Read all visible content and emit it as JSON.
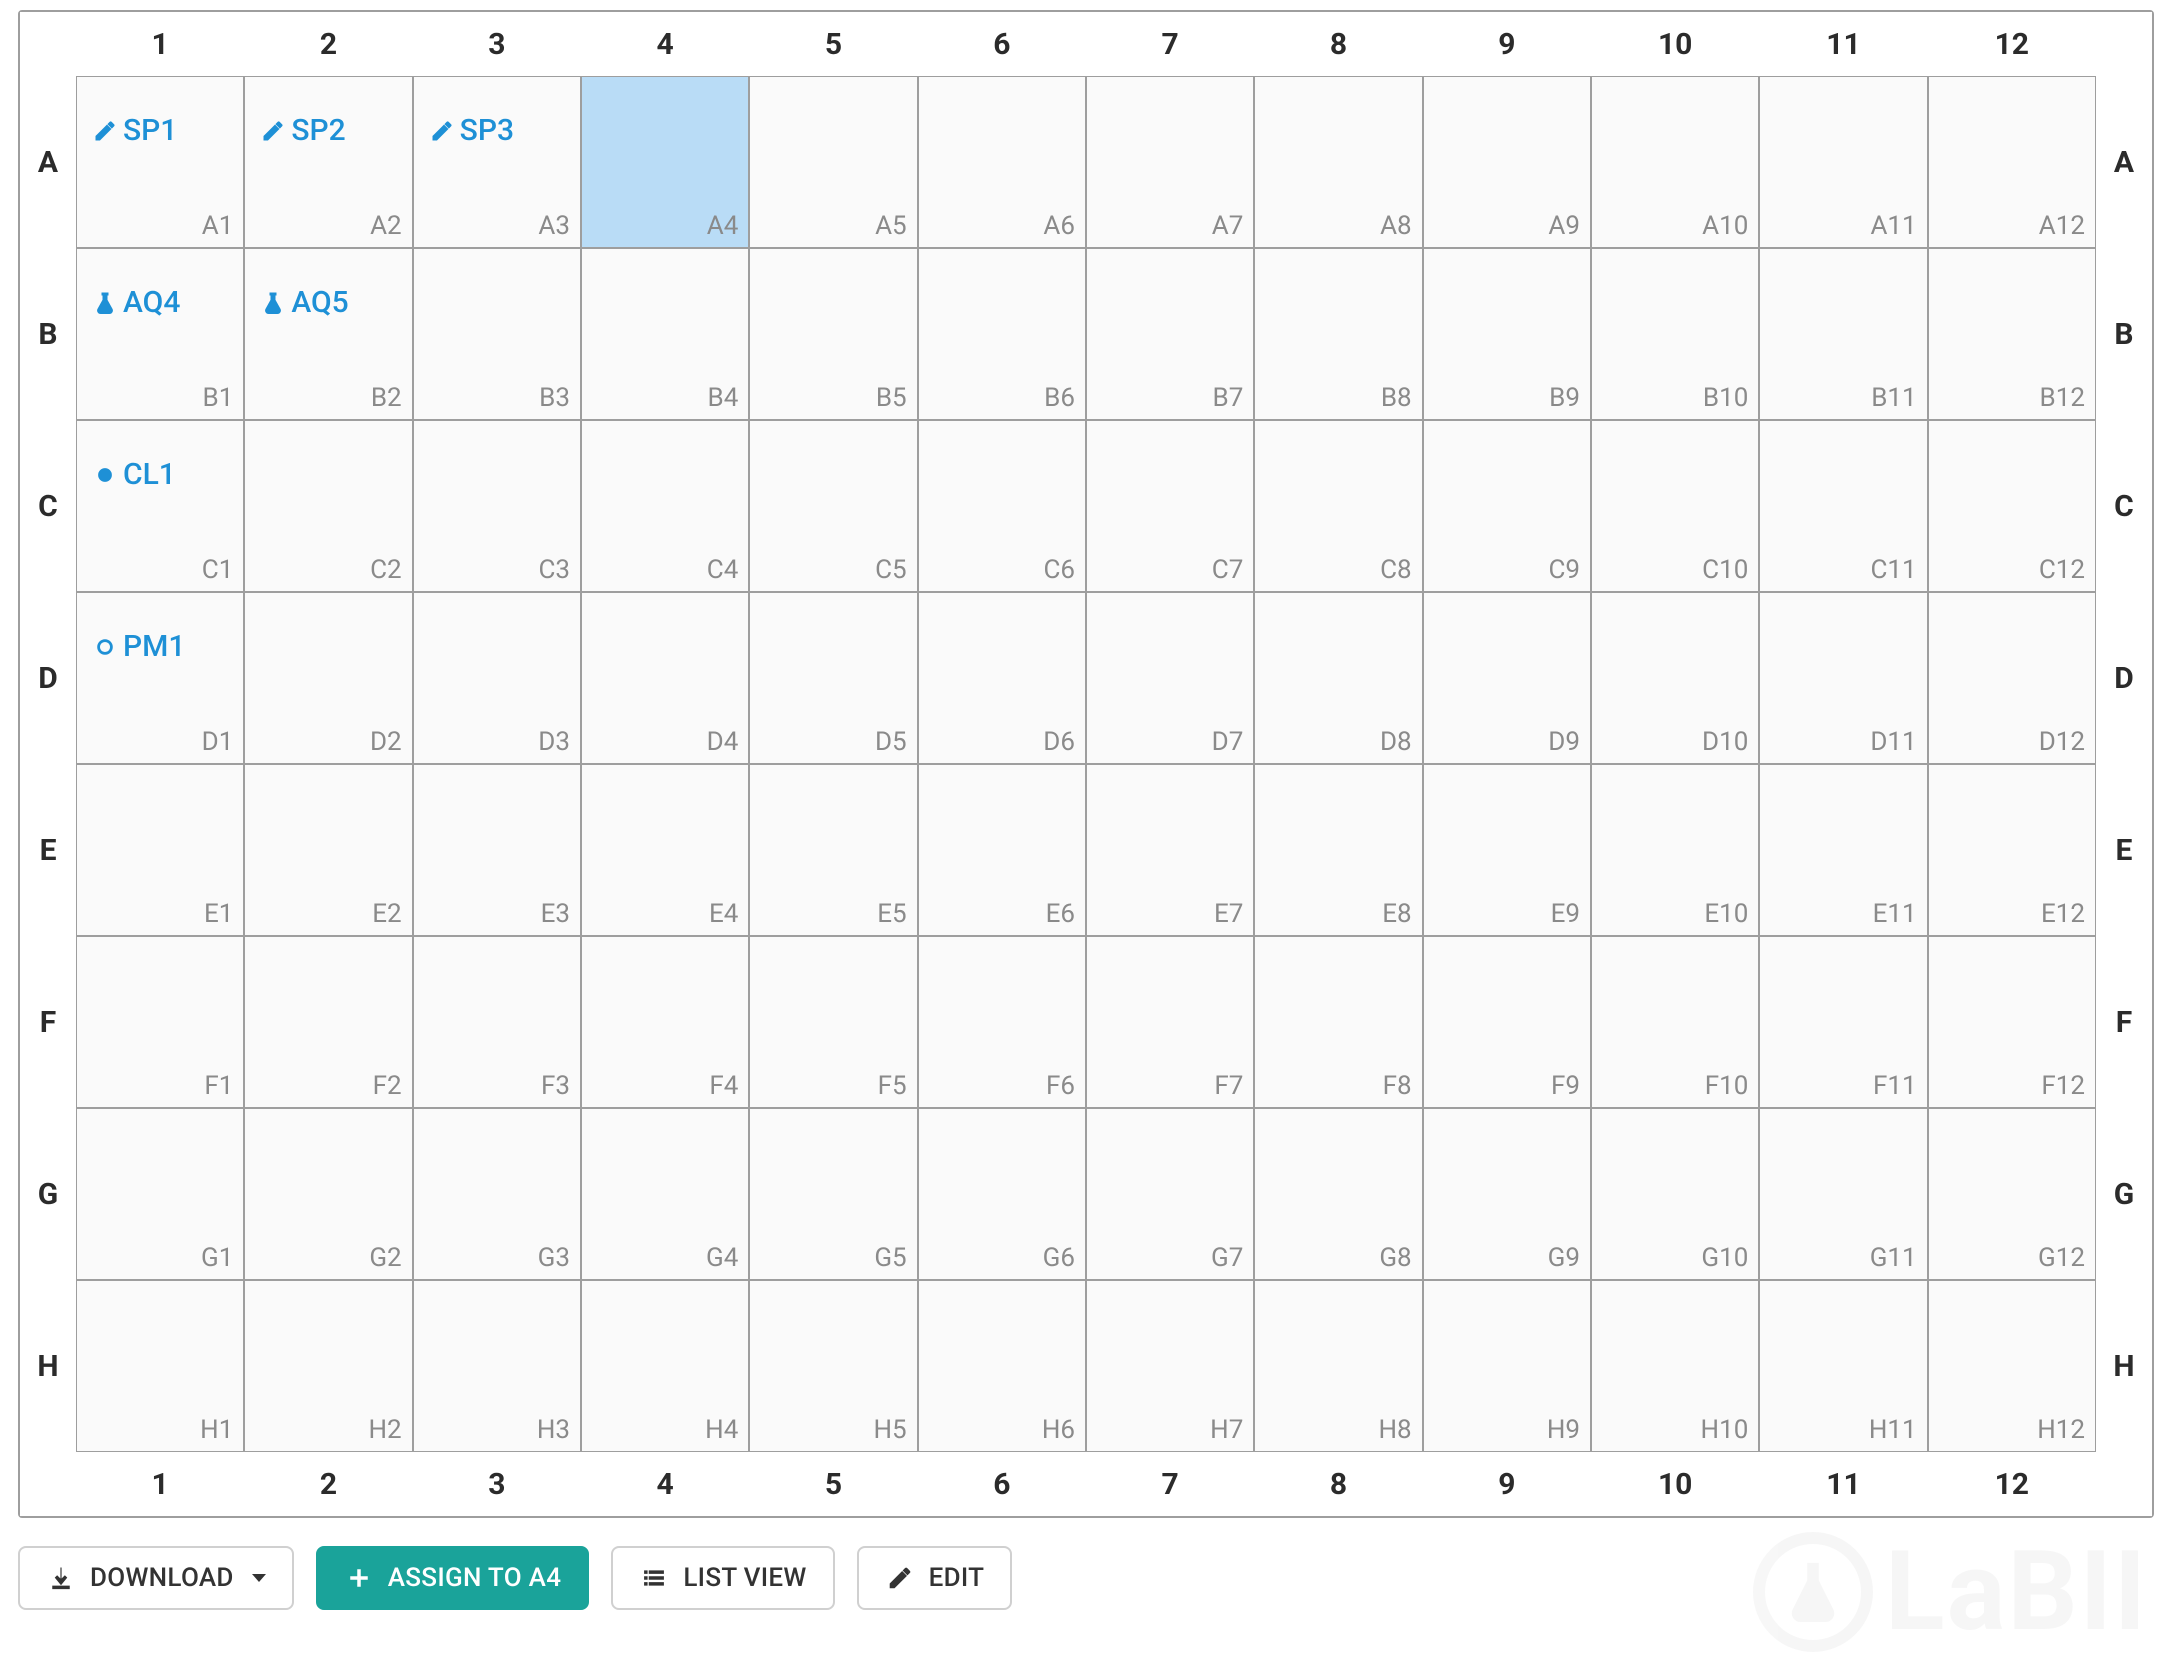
{
  "plate": {
    "columns": [
      "1",
      "2",
      "3",
      "4",
      "5",
      "6",
      "7",
      "8",
      "9",
      "10",
      "11",
      "12"
    ],
    "rows": [
      "A",
      "B",
      "C",
      "D",
      "E",
      "F",
      "G",
      "H"
    ],
    "selected_well": "A4",
    "samples": {
      "A1": {
        "label": "SP1",
        "icon": "pencil-icon"
      },
      "A2": {
        "label": "SP2",
        "icon": "pencil-icon"
      },
      "A3": {
        "label": "SP3",
        "icon": "pencil-icon"
      },
      "B1": {
        "label": "AQ4",
        "icon": "flask-icon"
      },
      "B2": {
        "label": "AQ5",
        "icon": "flask-icon"
      },
      "C1": {
        "label": "CL1",
        "icon": "dot-icon"
      },
      "D1": {
        "label": "PM1",
        "icon": "ring-icon"
      }
    }
  },
  "toolbar": {
    "download_label": "DOWNLOAD",
    "assign_label": "ASSIGN TO A4",
    "list_view_label": "LIST VIEW",
    "edit_label": "EDIT"
  },
  "watermark_text": "LaBII"
}
